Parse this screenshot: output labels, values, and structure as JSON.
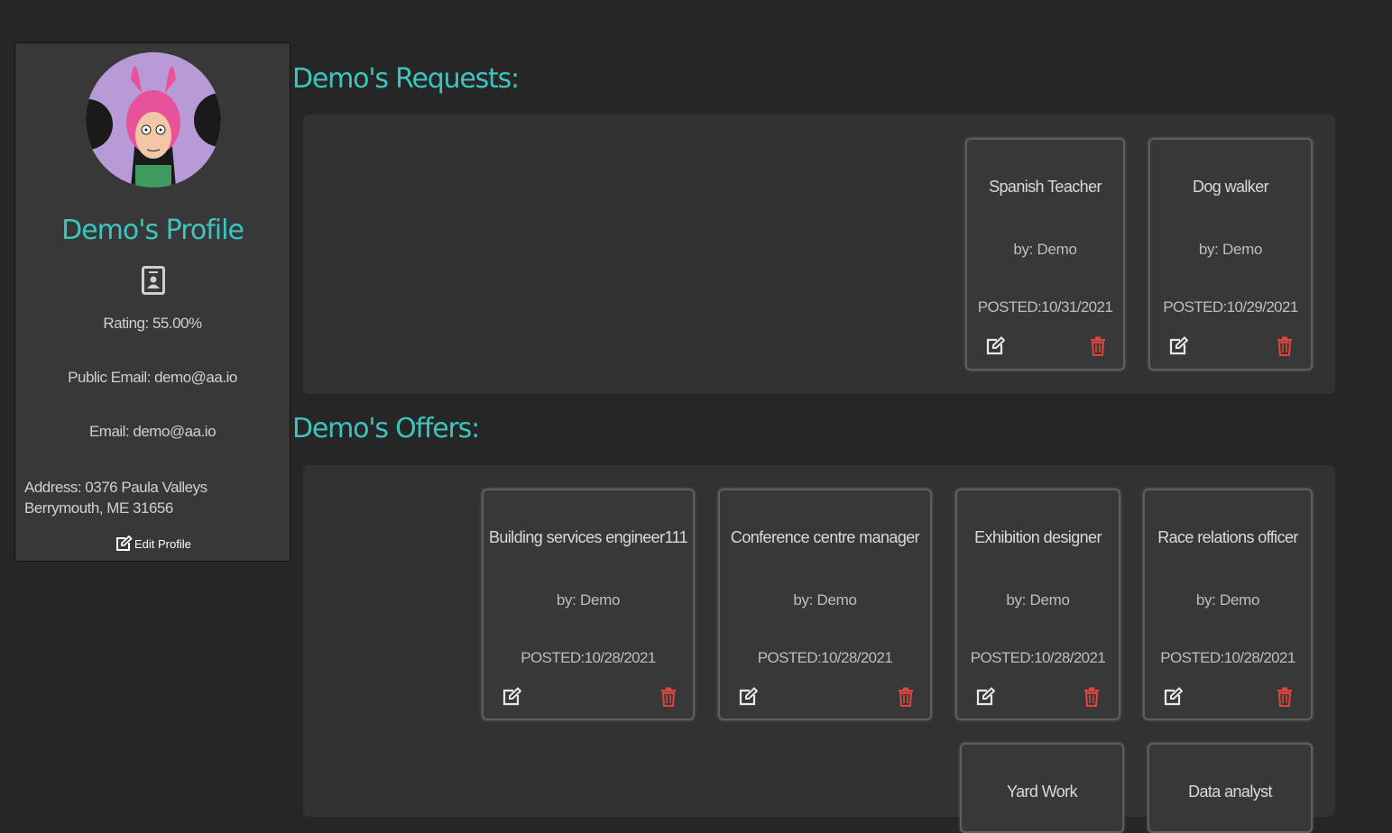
{
  "profile": {
    "title": "Demo's Profile",
    "rating": "Rating: 55.00%",
    "public_email": "Public Email: demo@aa.io",
    "email": "Email: demo@aa.io",
    "address_line1": "Address: 0376 Paula Valleys",
    "address_line2": "Berrymouth, ME 31656",
    "edit_label": "Edit Profile"
  },
  "requests": {
    "heading": "Demo's Requests:",
    "cards": [
      {
        "title": "Spanish Teacher",
        "by": "by: Demo",
        "posted": "POSTED:10/31/2021"
      },
      {
        "title": "Dog walker",
        "by": "by: Demo",
        "posted": "POSTED:10/29/2021"
      }
    ]
  },
  "offers": {
    "heading": "Demo's Offers:",
    "cards": [
      {
        "title": "Building services engineer111",
        "by": "by: Demo",
        "posted": "POSTED:10/28/2021"
      },
      {
        "title": "Conference centre manager",
        "by": "by: Demo",
        "posted": "POSTED:10/28/2021"
      },
      {
        "title": "Exhibition designer",
        "by": "by: Demo",
        "posted": "POSTED:10/28/2021"
      },
      {
        "title": "Race relations officer",
        "by": "by: Demo",
        "posted": "POSTED:10/28/2021"
      },
      {
        "title": "Yard Work"
      },
      {
        "title": "Data analyst"
      }
    ]
  },
  "colors": {
    "accent": "#3cc4bf",
    "delete": "#e0443e",
    "background": "#262626"
  }
}
